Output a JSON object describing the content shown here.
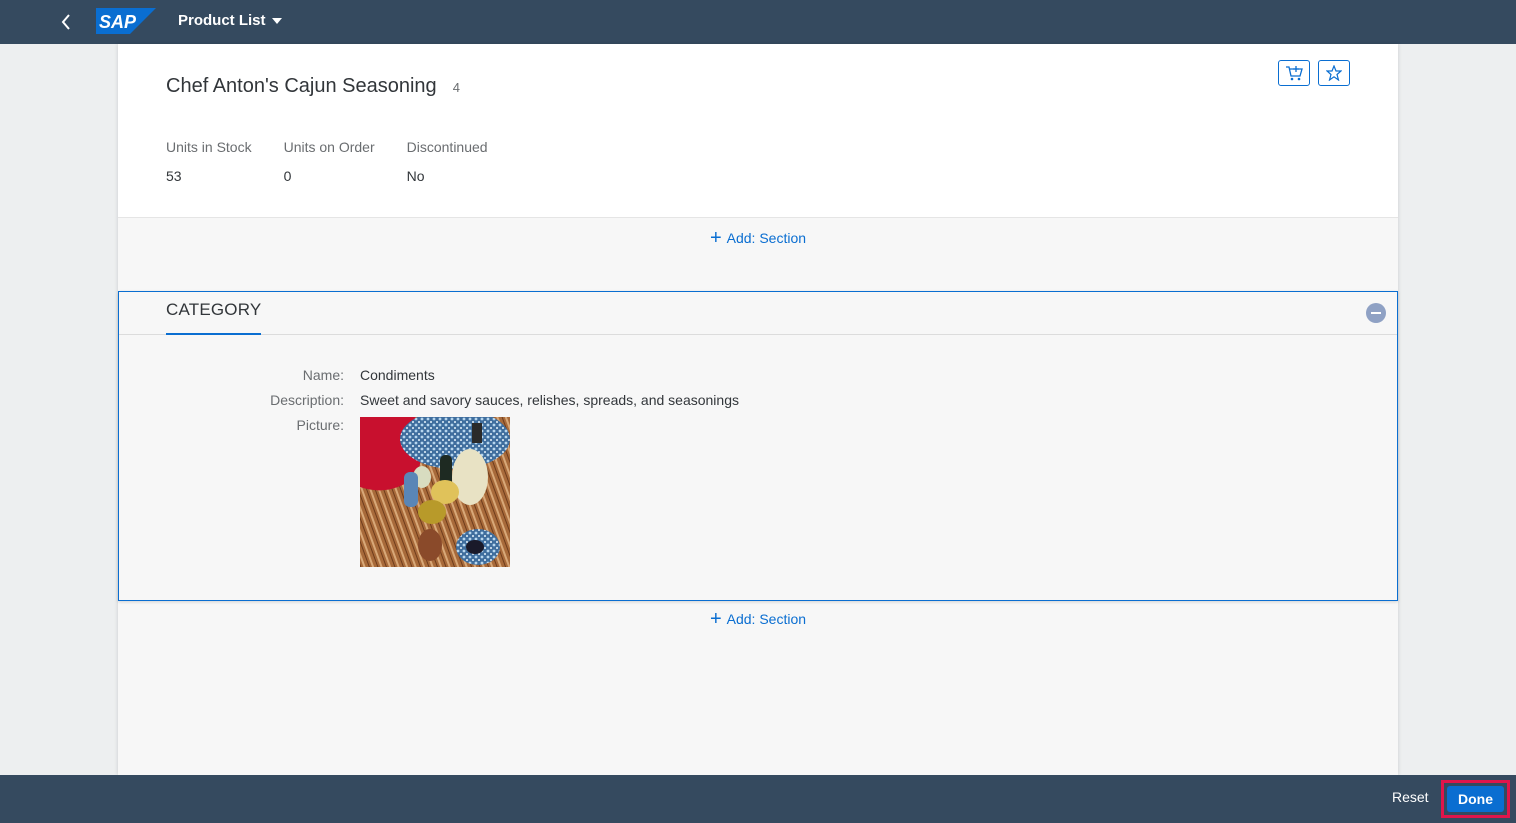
{
  "shell": {
    "app_title": "Product List",
    "logo_text": "SAP"
  },
  "header": {
    "title": "Chef Anton's Cajun Seasoning",
    "count": "4",
    "kpis": [
      {
        "label": "Units in Stock",
        "value": "53"
      },
      {
        "label": "Units on Order",
        "value": "0"
      },
      {
        "label": "Discontinued",
        "value": "No"
      }
    ]
  },
  "add_section_label": "Add: Section",
  "section": {
    "title": "CATEGORY",
    "fields": {
      "name_label": "Name:",
      "name_value": "Condiments",
      "description_label": "Description:",
      "description_value": "Sweet and savory sauces, relishes, spreads, and seasonings",
      "picture_label": "Picture:"
    }
  },
  "footer": {
    "reset_label": "Reset",
    "done_label": "Done"
  },
  "colors": {
    "shell": "#354a5f",
    "accent": "#0a6ed1",
    "highlight": "#e1154b"
  }
}
